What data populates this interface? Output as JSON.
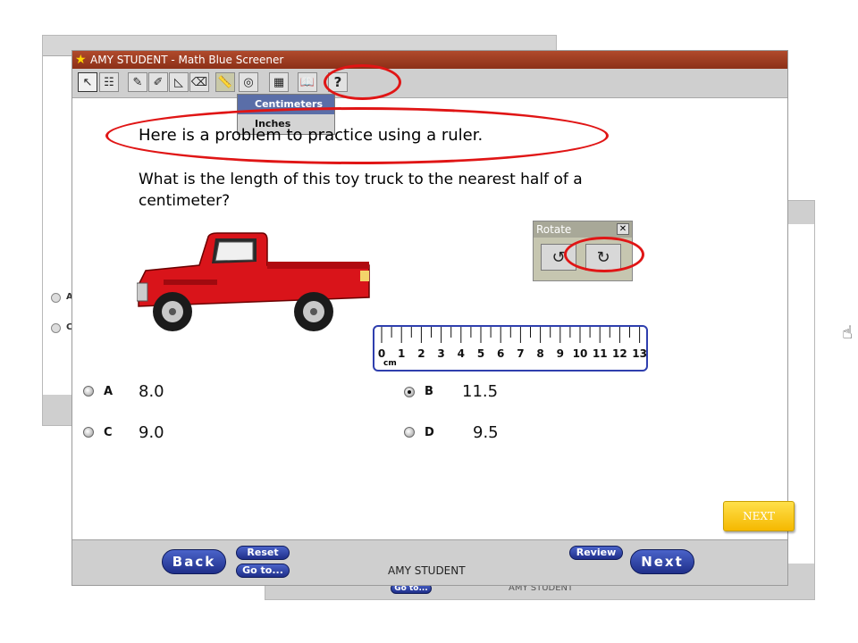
{
  "background_windows": {
    "back_a": {
      "options": [
        "A",
        "C"
      ]
    },
    "back_b": {
      "footer_name": "AMY  STUDENT",
      "goto_label": "Go to..."
    }
  },
  "window": {
    "title": "AMY  STUDENT - Math Blue Screener",
    "title_bar_color": "#a0401f"
  },
  "toolbar": {
    "tools": [
      {
        "name": "pointer-tool-icon",
        "glyph": "↖"
      },
      {
        "name": "eliminator-tool-icon",
        "glyph": "☷"
      },
      {
        "name": "highlighter-tool-icon",
        "glyph": "✎"
      },
      {
        "name": "pencil-tool-icon",
        "glyph": "✐"
      },
      {
        "name": "protractor-tool-icon",
        "glyph": "◺"
      },
      {
        "name": "eraser-tool-icon",
        "glyph": "⌫"
      },
      {
        "name": "ruler-tool-icon",
        "glyph": "📏"
      },
      {
        "name": "compass-tool-icon",
        "glyph": "◎"
      },
      {
        "name": "calculator-tool-icon",
        "glyph": "▦"
      },
      {
        "name": "book-tool-icon",
        "glyph": "📖"
      },
      {
        "name": "help-tool-icon",
        "glyph": "?"
      }
    ]
  },
  "ruler_menu": {
    "items": [
      "Centimeters",
      "Inches"
    ],
    "selected": "Centimeters"
  },
  "question": {
    "intro": "Here is a problem to practice using a ruler.",
    "text": "What is the length of this toy truck to the nearest half of a centimeter?"
  },
  "rotate_dialog": {
    "title": "Rotate",
    "close_glyph": "✕",
    "ccw_glyph": "↺",
    "cw_glyph": "↻"
  },
  "ruler": {
    "labels": [
      "0",
      "1",
      "2",
      "3",
      "4",
      "5",
      "6",
      "7",
      "8",
      "9",
      "10",
      "11",
      "12",
      "13"
    ],
    "unit": "cm",
    "border_color": "#2f3fae"
  },
  "options": [
    {
      "letter": "A",
      "value": "8.0",
      "selected": false
    },
    {
      "letter": "B",
      "value": "11.5",
      "selected": true
    },
    {
      "letter": "C",
      "value": "9.0",
      "selected": false
    },
    {
      "letter": "D",
      "value": "9.5",
      "selected": false
    }
  ],
  "next_side_button": {
    "label": "NEXT",
    "color": "#f5c000"
  },
  "bottom": {
    "back_label": "Back",
    "reset_label": "Reset",
    "goto_label": "Go to...",
    "review_label": "Review",
    "next_label": "Next",
    "student_name": "AMY  STUDENT",
    "pill_color": "#2a3c9e"
  },
  "annotation_color": "#e01515"
}
